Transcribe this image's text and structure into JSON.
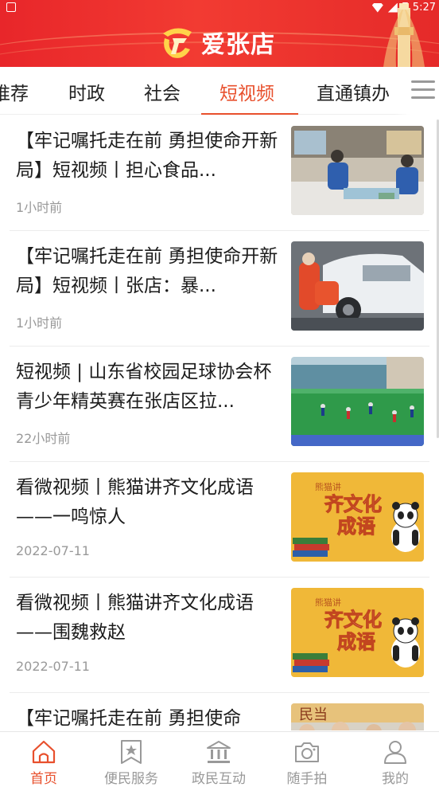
{
  "status_bar": {
    "time": "5:27"
  },
  "header": {
    "app_name": "爱张店"
  },
  "tabs": [
    {
      "label": "推荐"
    },
    {
      "label": "时政"
    },
    {
      "label": "社会"
    },
    {
      "label": "短视频",
      "active": true
    },
    {
      "label": "直通镇办"
    }
  ],
  "articles": [
    {
      "title": "【牢记嘱托走在前 勇担使命开新局】短视频丨担心食品安全问题",
      "display_title": "【牢记嘱托走在前 勇担使命开新局】短视频丨担心食品...",
      "time": "1小时前",
      "thumb": "market-inspection"
    },
    {
      "title": "【牢记嘱托走在前 勇担使命开新局】短视频丨张店：暴雨",
      "display_title": "【牢记嘱托走在前 勇担使命开新局】短视频丨张店：暴...",
      "time": "1小时前",
      "thumb": "rescue-car"
    },
    {
      "title": "短视频 | 山东省校园足球协会杯青少年精英赛在张店区拉开",
      "display_title": "短视频 | 山东省校园足球协会杯青少年精英赛在张店区拉...",
      "time": "22小时前",
      "thumb": "football-field"
    },
    {
      "title": "看微视频丨熊猫讲齐文化成语——一鸣惊人",
      "display_title": "看微视频丨熊猫讲齐文化成语——一鸣惊人",
      "time": "2022-07-11",
      "thumb": "panda-idiom"
    },
    {
      "title": "看微视频丨熊猫讲齐文化成语——围魏救赵",
      "display_title": "看微视频丨熊猫讲齐文化成语——围魏救赵",
      "time": "2022-07-11",
      "thumb": "panda-idiom"
    },
    {
      "title": "【牢记嘱托走在前 勇担使命",
      "display_title": "【牢记嘱托走在前 勇担使命",
      "time": "",
      "thumb": "people-portrait"
    }
  ],
  "thumb_text": {
    "panda_small": "熊猫讲",
    "panda_big1": "齐文化",
    "panda_big2": "成语",
    "portrait_sign": "民当"
  },
  "bottom_nav": [
    {
      "label": "首页",
      "icon": "home-icon",
      "active": true
    },
    {
      "label": "便民服务",
      "icon": "star-bookmark-icon"
    },
    {
      "label": "政民互动",
      "icon": "government-building-icon"
    },
    {
      "label": "随手拍",
      "icon": "camera-icon"
    },
    {
      "label": "我的",
      "icon": "user-icon"
    }
  ],
  "colors": {
    "accent": "#e8502d",
    "header_red": "#e8262a",
    "inactive": "#999999"
  }
}
